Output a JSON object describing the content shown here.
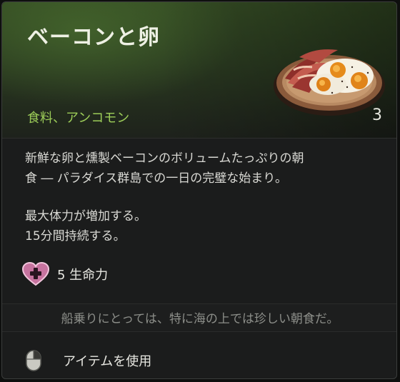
{
  "item": {
    "title": "ベーコンと卵",
    "category": "食料、アンコモン",
    "count": "3",
    "icon": "bacon-and-eggs-plate"
  },
  "description": {
    "line1": "新鮮な卵と燻製ベーコンのボリュームたっぷりの朝",
    "line2": "食 ― パラダイス群島での一日の完璧な始まり。",
    "effect_line1": "最大体力が増加する。",
    "effect_line2": "15分間持続する。"
  },
  "stat": {
    "icon": "health-heart-icon",
    "label": "5 生命力",
    "color": "#d77fb0"
  },
  "flavor_text": "船乗りにとっては、特に海の上では珍しい朝食だ。",
  "action": {
    "icon": "mouse-right-click-icon",
    "label": "アイテムを使用"
  },
  "colors": {
    "category": "#9ccc58",
    "header_green": "#334a23",
    "panel": "#1b1c1c"
  }
}
